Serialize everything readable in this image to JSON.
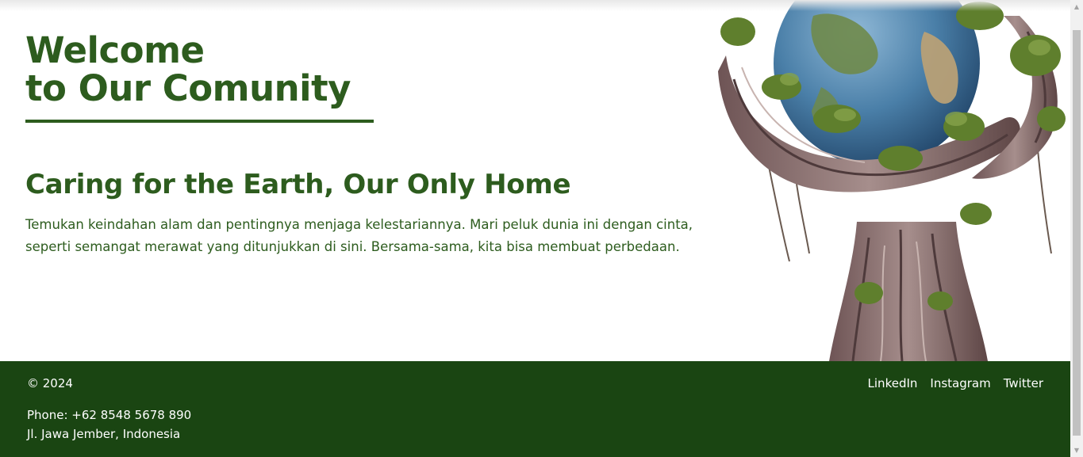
{
  "hero": {
    "title_line1": "Welcome",
    "title_line2": "to Our Comunity",
    "subtitle": "Caring for the Earth, Our Only Home",
    "description": "Temukan keindahan alam dan pentingnya menjaga kelestariannya. Mari peluk dunia ini dengan cinta, seperti semangat merawat yang ditunjukkan di sini. Bersama-sama, kita bisa membuat perbedaan.",
    "image_icon": "tree-holding-earth-illustration"
  },
  "footer": {
    "copyright": "© 2024",
    "phone": "Phone: +62 8548 5678 890",
    "address": "Jl. Jawa Jember, Indonesia",
    "links": [
      "LinkedIn",
      "Instagram",
      "Twitter"
    ]
  },
  "colors": {
    "primary_green": "#2d5c1e",
    "footer_bg": "#1a4512",
    "text_white": "#ffffff"
  }
}
